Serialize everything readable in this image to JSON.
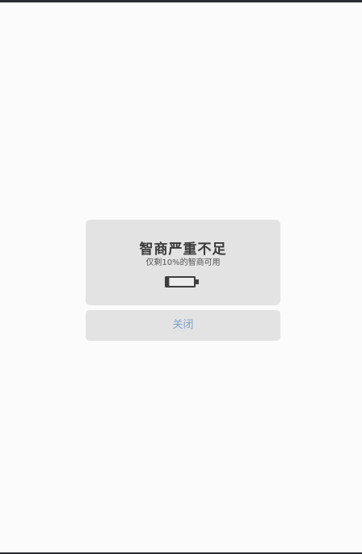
{
  "dialog": {
    "title": "智商严重不足",
    "subtitle": "仅剩10%的智商可用",
    "icon": "battery-low-icon",
    "battery_level": 0.1,
    "close_label": "关闭"
  },
  "colors": {
    "background": "#fbfbfc",
    "card": "#e3e3e3",
    "title_text": "#3a3a3a",
    "battery_icon": "#3e3e3e",
    "close_text": "#7c9fc4"
  }
}
